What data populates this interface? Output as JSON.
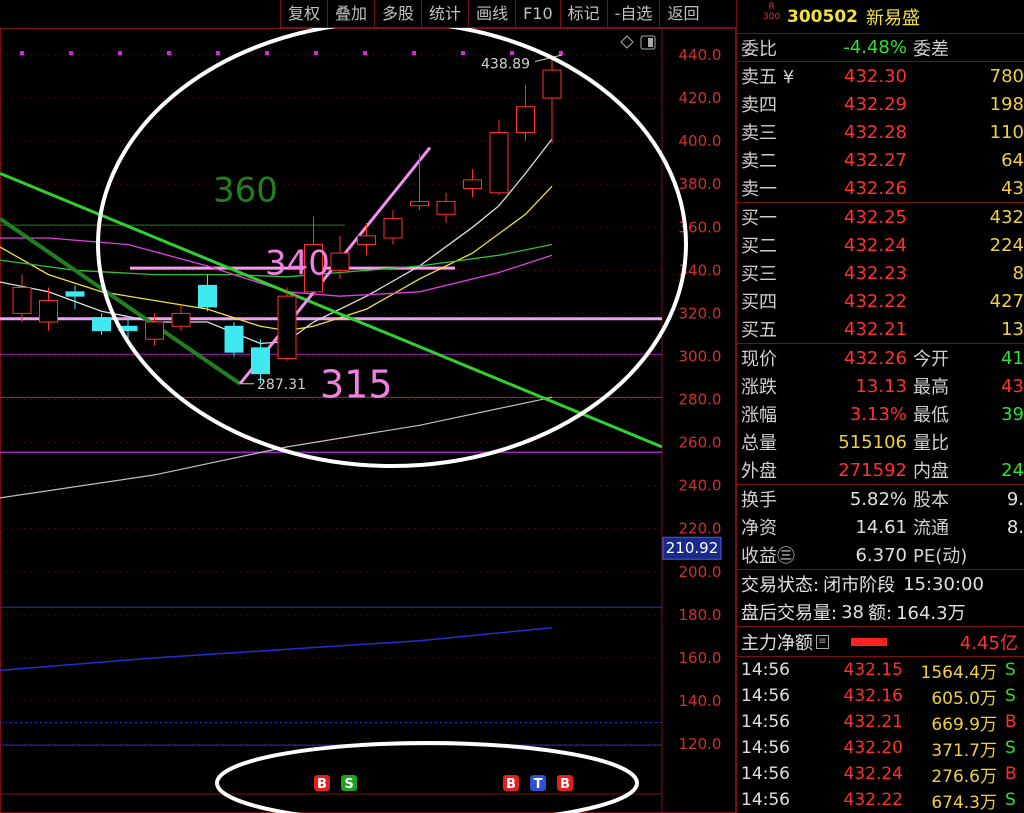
{
  "toolbar": {
    "buttons": [
      "复权",
      "叠加",
      "多股",
      "统计",
      "画线",
      "F10",
      "标记",
      "-自选",
      "返回"
    ]
  },
  "chart": {
    "y_axis_ticks": [
      "440.0",
      "420.0",
      "400.0",
      "380.0",
      "360.0",
      "340.0",
      "320.0",
      "300.0",
      "280.0",
      "260.0",
      "240.0",
      "220.0",
      "200.0",
      "180.0",
      "160.0",
      "140.0",
      "120.0"
    ],
    "current_price_marker": "210.92",
    "high_label": "438.89",
    "low_label": "287.31",
    "annotations": [
      "360",
      "340",
      "315"
    ],
    "signal_markers": [
      {
        "text": "B",
        "color": "#e02020"
      },
      {
        "text": "S",
        "color": "#20a020"
      },
      {
        "text": "B",
        "color": "#e02020"
      },
      {
        "text": "T",
        "color": "#3050d0"
      },
      {
        "text": "B",
        "color": "#e02020"
      }
    ],
    "colors": {
      "up": "#ff3030",
      "down": "#40e8f0",
      "ma5": "#e0e0e0",
      "ma10": "#f0e040",
      "ma20": "#30c030",
      "ma30": "#e040e0",
      "long_ma": "#c0c0c0",
      "ma250": "#2030d0"
    }
  },
  "chart_data": {
    "type": "candlestick",
    "ylim": [
      110,
      450
    ],
    "candles": [
      {
        "open": 320,
        "close": 332,
        "high": 338,
        "low": 316
      },
      {
        "open": 316,
        "close": 326,
        "high": 332,
        "low": 312
      },
      {
        "open": 330,
        "close": 328,
        "high": 333,
        "low": 322
      },
      {
        "open": 318,
        "close": 312,
        "high": 320,
        "low": 310
      },
      {
        "open": 314,
        "close": 312,
        "high": 318,
        "low": 306
      },
      {
        "open": 308,
        "close": 316,
        "high": 320,
        "low": 305
      },
      {
        "open": 314,
        "close": 320,
        "high": 324,
        "low": 312
      },
      {
        "open": 333,
        "close": 323,
        "high": 338,
        "low": 321
      },
      {
        "open": 314,
        "close": 302,
        "high": 316,
        "low": 300
      },
      {
        "open": 304,
        "close": 292,
        "high": 308,
        "low": 287.31
      },
      {
        "open": 299,
        "close": 328,
        "high": 332,
        "low": 298
      },
      {
        "open": 330,
        "close": 352,
        "high": 365,
        "low": 328
      },
      {
        "open": 340,
        "close": 348,
        "high": 356,
        "low": 336
      },
      {
        "open": 352,
        "close": 356,
        "high": 362,
        "low": 347
      },
      {
        "open": 355,
        "close": 364,
        "high": 368,
        "low": 352
      },
      {
        "open": 370,
        "close": 372,
        "high": 394,
        "low": 368
      },
      {
        "open": 366,
        "close": 372,
        "high": 376,
        "low": 362
      },
      {
        "open": 378,
        "close": 382,
        "high": 387,
        "low": 374
      },
      {
        "open": 376,
        "close": 404,
        "high": 410,
        "low": 375
      },
      {
        "open": 404,
        "close": 416,
        "high": 426,
        "low": 400
      },
      {
        "open": 420,
        "close": 433,
        "high": 438.89,
        "low": 399
      }
    ]
  },
  "panel": {
    "r_badge": "R",
    "r_num": "300",
    "code": "300502",
    "name": "新易盛",
    "weibi_label": "委比",
    "weibi_value": "-4.48%",
    "weicha_label": "委差",
    "sells": [
      {
        "label": "卖五 ¥",
        "price": "432.30",
        "vol": "780"
      },
      {
        "label": "卖四",
        "price": "432.29",
        "vol": "198"
      },
      {
        "label": "卖三",
        "price": "432.28",
        "vol": "110"
      },
      {
        "label": "卖二",
        "price": "432.27",
        "vol": "64"
      },
      {
        "label": "卖一",
        "price": "432.26",
        "vol": "43"
      }
    ],
    "buys": [
      {
        "label": "买一",
        "price": "432.25",
        "vol": "432"
      },
      {
        "label": "买二",
        "price": "432.24",
        "vol": "224"
      },
      {
        "label": "买三",
        "price": "432.23",
        "vol": "8"
      },
      {
        "label": "买四",
        "price": "432.22",
        "vol": "427"
      },
      {
        "label": "买五",
        "price": "432.21",
        "vol": "13"
      }
    ],
    "stats": [
      {
        "l1": "现价",
        "v1": "432.26",
        "c1": "red",
        "l2": "今开",
        "v2": "41",
        "c2": "green"
      },
      {
        "l1": "涨跌",
        "v1": "13.13",
        "c1": "red",
        "l2": "最高",
        "v2": "43",
        "c2": "red"
      },
      {
        "l1": "涨幅",
        "v1": "3.13%",
        "c1": "red",
        "l2": "最低",
        "v2": "39",
        "c2": "green"
      },
      {
        "l1": "总量",
        "v1": "515106",
        "c1": "yellow",
        "l2": "量比",
        "v2": "",
        "c2": "white"
      },
      {
        "l1": "外盘",
        "v1": "271592",
        "c1": "red",
        "l2": "内盘",
        "v2": "24",
        "c2": "green"
      }
    ],
    "fin": [
      {
        "l1": "换手",
        "v1": "5.82%",
        "l2": "股本",
        "v2": "9."
      },
      {
        "l1": "净资",
        "v1": "14.61",
        "l2": "流通",
        "v2": "8."
      },
      {
        "l1": "收益㊂",
        "v1": "6.370",
        "l2": "PE(动)",
        "v2": ""
      }
    ],
    "trade_status_label": "交易状态:",
    "trade_status_value": "闭市阶段",
    "trade_status_time": "15:30:00",
    "after_label": "盘后交易量:",
    "after_vol": "38",
    "amt_label": "额:",
    "amt_value": "164.3万",
    "net_label": "主力净额",
    "net_value": "4.45亿",
    "ticks": [
      {
        "time": "14:56",
        "price": "432.15",
        "vol": "1564.4万",
        "bs": "S"
      },
      {
        "time": "14:56",
        "price": "432.16",
        "vol": "605.0万",
        "bs": "S"
      },
      {
        "time": "14:56",
        "price": "432.21",
        "vol": "669.9万",
        "bs": "B"
      },
      {
        "time": "14:56",
        "price": "432.20",
        "vol": "371.7万",
        "bs": "S"
      },
      {
        "time": "14:56",
        "price": "432.24",
        "vol": "276.6万",
        "bs": "B"
      },
      {
        "time": "14:56",
        "price": "432.22",
        "vol": "674.3万",
        "bs": "S"
      }
    ]
  }
}
